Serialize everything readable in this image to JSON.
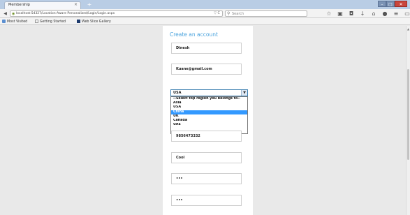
{
  "browser": {
    "tab_title": "Membership",
    "tab_close": "×",
    "new_tab": "+",
    "window_controls": [
      "–",
      "□",
      "✕"
    ],
    "url": "localhost:54327/Location-Aware Personalized/Login/Login.aspx",
    "url_right": "▽ C",
    "search_placeholder": "Search",
    "bookmarks": [
      "Most Visited",
      "Getting Started",
      "Web Slice Gallery"
    ],
    "icons": [
      "star-icon",
      "reading-list-icon",
      "pocket-icon",
      "download-icon",
      "home-icon",
      "sync-icon",
      "menu-icon",
      "screenshot-icon"
    ]
  },
  "form": {
    "title": "Create an account",
    "name_value": "Dinesh",
    "email_value": "Kuane@gmail.com",
    "region_select": {
      "selected": "USA",
      "options": [
        "--Select top region you belongs to--",
        "Asia",
        "USA",
        "China",
        "UK",
        "Canada",
        "UAE"
      ],
      "highlighted_index": 3
    },
    "phone_value": "9856473332",
    "nickname_value": "Cool",
    "password_value": "•••",
    "confirm_password_value": "•••"
  },
  "colors": {
    "title_accent": "#4aa3dd",
    "highlight": "#3399ff",
    "page_background": "#e9e9e9"
  }
}
